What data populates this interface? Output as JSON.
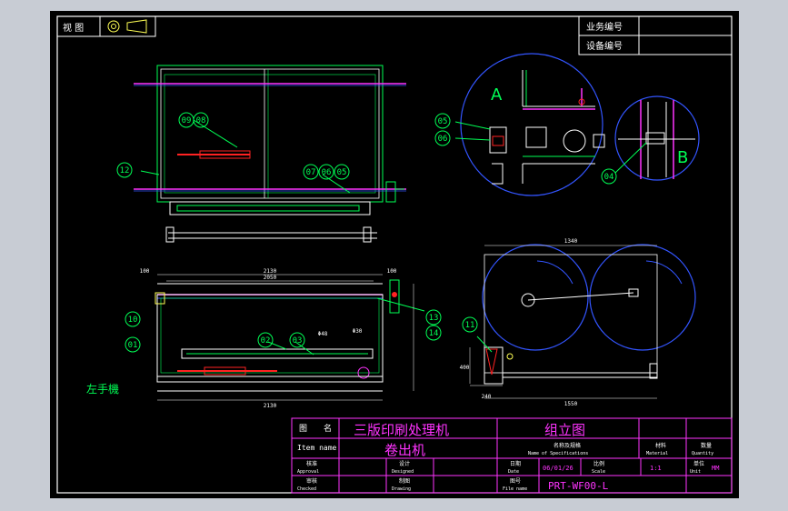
{
  "header": {
    "view_cell": "视 图",
    "business_no_label": "业务编号",
    "equipment_no_label": "设备编号"
  },
  "detail_labels": {
    "a": "A",
    "b": "B"
  },
  "balloons": {
    "top_view": [
      "12",
      "09",
      "08",
      "07",
      "06",
      "05"
    ],
    "detail_a": [
      "05",
      "06"
    ],
    "detail_b": [
      "04"
    ],
    "front_view": [
      "10",
      "01",
      "02",
      "03",
      "13",
      "14"
    ],
    "side_view": [
      "11"
    ]
  },
  "dimensions": {
    "front_total": "2130",
    "front_inner": "2050",
    "front_left": "100",
    "front_right": "100",
    "front_bottom": "2130",
    "side_width": "1340",
    "side_bottom": "1550",
    "side_foot": "240",
    "side_height": "400",
    "pipe_label": "Φ48",
    "shaft_label": "Φ30"
  },
  "side_note": "左手機",
  "title_block": {
    "name_label": "图　　名",
    "name_label_en": "Item name",
    "product_name": "三版印刷处理机",
    "product_sub": "卷出机",
    "drawing_type": "组立图",
    "material_label": "材料",
    "material_en": "Material",
    "quantity_label": "数量",
    "quantity_en": "Quantity",
    "approve_label": "核准",
    "approve_en": "Approval",
    "check_label": "审核",
    "check_en": "Checked",
    "design_label": "设计",
    "design_en": "Designed",
    "draw_label": "制图",
    "draw_en": "Drawing",
    "date_label": "日期",
    "date_en": "Date",
    "date_value": "06/01/26",
    "scale_label": "比例",
    "scale_en": "Scale",
    "scale_value": "1:1",
    "unit_label": "单位",
    "unit_en": "Unit",
    "unit_value": "MM",
    "number_label": "图号",
    "number_en": "File name",
    "number_value": "PRT-WF00-L",
    "name_code_label": "名称及规格",
    "name_code_en": "Name of Specifications"
  },
  "colors": {
    "frame": "#ffffff",
    "outline": "#ffffff",
    "green": "#00ff55",
    "magenta": "#ff33ff",
    "blue": "#3355ff",
    "red": "#ff2222",
    "yellow": "#ffff55",
    "cyan": "#33ffff"
  }
}
